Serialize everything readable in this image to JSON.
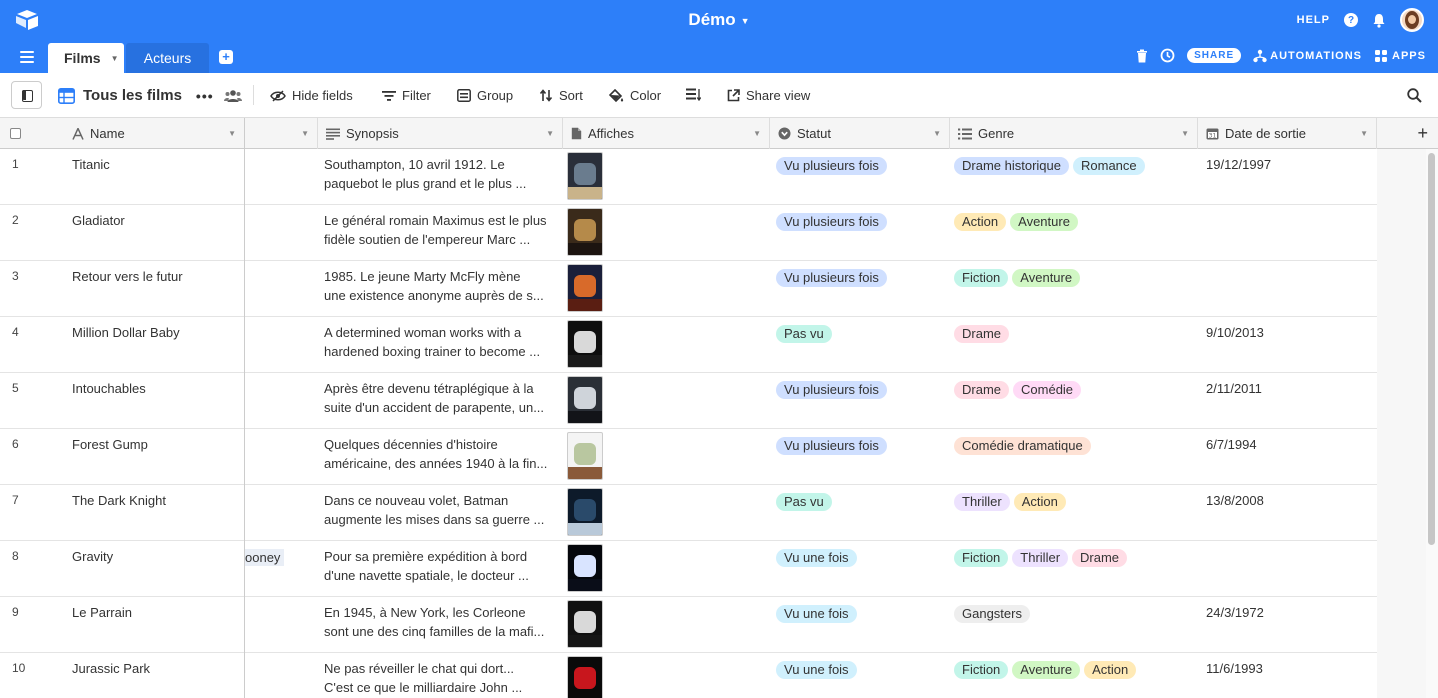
{
  "base": {
    "title": "Démo"
  },
  "topbar": {
    "help_label": "HELP"
  },
  "tabs": [
    {
      "label": "Films"
    },
    {
      "label": "Acteurs"
    }
  ],
  "tabbar_right": {
    "share_label": "SHARE",
    "automations_label": "AUTOMATIONS",
    "apps_label": "APPS"
  },
  "toolbar": {
    "view_name": "Tous les films",
    "hide_fields": "Hide fields",
    "filter": "Filter",
    "group": "Group",
    "sort": "Sort",
    "color": "Color",
    "share_view": "Share view"
  },
  "columns": {
    "name": "Name",
    "synopsis": "Synopsis",
    "affiches": "Affiches",
    "statut": "Statut",
    "genre": "Genre",
    "date": "Date de sortie"
  },
  "colors": {
    "header_blue": "#2d7ff9",
    "status_vu_plusieurs": "#cfdfff",
    "status_pas_vu": "#c2f5e9",
    "status_vu_une_fois": "#d0f0fd"
  },
  "rows": [
    {
      "num": "1",
      "name": "Titanic",
      "actor": "",
      "syn1": "Southampton, 10 avril 1912. Le",
      "syn2": "paquebot le plus grand et le plus ...",
      "status": "Vu plusieurs fois",
      "status_color": "blue",
      "genres": [
        {
          "label": "Drame historique",
          "color": "blue"
        },
        {
          "label": "Romance",
          "color": "sky"
        }
      ],
      "date": "19/12/1997"
    },
    {
      "num": "2",
      "name": "Gladiator",
      "actor": "",
      "syn1": "Le général romain Maximus est le plus",
      "syn2": "fidèle soutien de l'empereur Marc ...",
      "status": "Vu plusieurs fois",
      "status_color": "blue",
      "genres": [
        {
          "label": "Action",
          "color": "yellow"
        },
        {
          "label": "Aventure",
          "color": "green"
        }
      ],
      "date": ""
    },
    {
      "num": "3",
      "name": "Retour vers le futur",
      "actor": "",
      "syn1": " 1985. Le jeune Marty McFly mène",
      "syn2": "une existence anonyme auprès de s...",
      "status": "Vu plusieurs fois",
      "status_color": "blue",
      "genres": [
        {
          "label": "Fiction",
          "color": "teal"
        },
        {
          "label": "Aventure",
          "color": "green"
        }
      ],
      "date": ""
    },
    {
      "num": "4",
      "name": "Million Dollar Baby",
      "actor": "",
      "syn1": "A determined woman works with a",
      "syn2": "hardened boxing trainer to become ...",
      "status": "Pas vu",
      "status_color": "teal",
      "genres": [
        {
          "label": "Drame",
          "color": "pink"
        }
      ],
      "date": "9/10/2013"
    },
    {
      "num": "5",
      "name": "Intouchables",
      "actor": "",
      "syn1": "Après être devenu tétraplégique à la",
      "syn2": "suite d'un accident de parapente, un...",
      "status": "Vu plusieurs fois",
      "status_color": "blue",
      "genres": [
        {
          "label": "Drame",
          "color": "pink"
        },
        {
          "label": "Comédie",
          "color": "magenta"
        }
      ],
      "date": "2/11/2011"
    },
    {
      "num": "6",
      "name": "Forest Gump",
      "actor": "",
      "syn1": "Quelques décennies d'histoire",
      "syn2": "américaine, des années 1940 à la fin...",
      "status": "Vu plusieurs fois",
      "status_color": "blue",
      "genres": [
        {
          "label": "Comédie dramatique",
          "color": "orange"
        }
      ],
      "date": "6/7/1994"
    },
    {
      "num": "7",
      "name": "The Dark Knight",
      "actor": "",
      "syn1": "Dans ce nouveau volet, Batman",
      "syn2": "augmente les mises dans sa guerre ...",
      "status": "Pas vu",
      "status_color": "teal",
      "genres": [
        {
          "label": "Thriller",
          "color": "purple"
        },
        {
          "label": "Action",
          "color": "yellow"
        }
      ],
      "date": "13/8/2008"
    },
    {
      "num": "8",
      "name": "Gravity",
      "actor": "ooney",
      "syn1": "Pour sa première expédition à bord",
      "syn2": "d'une navette spatiale, le docteur ...",
      "status": "Vu une fois",
      "status_color": "sky",
      "genres": [
        {
          "label": "Fiction",
          "color": "teal"
        },
        {
          "label": "Thriller",
          "color": "purple"
        },
        {
          "label": "Drame",
          "color": "pink"
        }
      ],
      "date": ""
    },
    {
      "num": "9",
      "name": "Le Parrain",
      "actor": "",
      "syn1": "En 1945, à New York, les Corleone",
      "syn2": "sont une des cinq familles de la mafi...",
      "status": "Vu une fois",
      "status_color": "sky",
      "genres": [
        {
          "label": "Gangsters",
          "color": "gray"
        }
      ],
      "date": "24/3/1972"
    },
    {
      "num": "10",
      "name": "Jurassic Park",
      "actor": "",
      "syn1": "Ne pas réveiller le chat qui dort...",
      "syn2": "C'est ce que le milliardaire John ...",
      "status": "Vu une fois",
      "status_color": "sky",
      "genres": [
        {
          "label": "Fiction",
          "color": "teal"
        },
        {
          "label": "Aventure",
          "color": "green"
        },
        {
          "label": "Action",
          "color": "yellow"
        }
      ],
      "date": "11/6/1993"
    }
  ]
}
